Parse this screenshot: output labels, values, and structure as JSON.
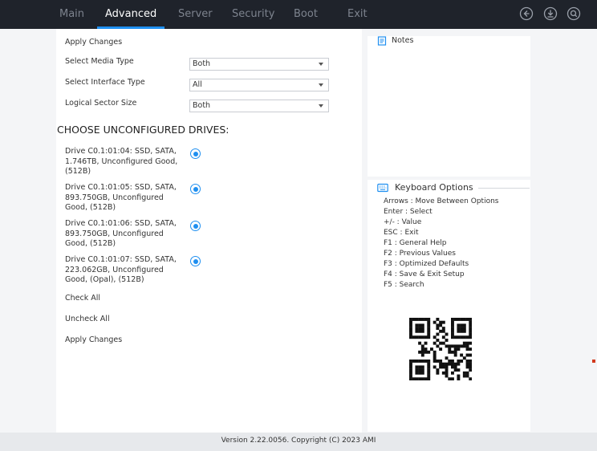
{
  "nav": {
    "tabs": [
      {
        "label": "Main"
      },
      {
        "label": "Advanced"
      },
      {
        "label": "Server"
      },
      {
        "label": "Security"
      },
      {
        "label": "Boot"
      },
      {
        "label": "Exit"
      }
    ],
    "active_tab": "Advanced",
    "icons": [
      "back-icon",
      "save-icon",
      "search-icon"
    ]
  },
  "form": {
    "apply_top": "Apply Changes",
    "media_label": "Select Media Type",
    "media_value": "Both",
    "interface_label": "Select Interface Type",
    "interface_value": "All",
    "sector_label": "Logical Sector Size",
    "sector_value": "Both",
    "heading": "CHOOSE UNCONFIGURED DRIVES:",
    "drives": [
      {
        "lines": [
          "Drive C0.1:01:04: SSD, SATA,",
          "1.746TB, Unconfigured Good,",
          "(512B)"
        ],
        "selected": true
      },
      {
        "lines": [
          "Drive C0.1:01:05: SSD, SATA,",
          "893.750GB, Unconfigured",
          "Good, (512B)"
        ],
        "selected": true
      },
      {
        "lines": [
          "Drive C0.1:01:06: SSD, SATA,",
          "893.750GB, Unconfigured",
          "Good, (512B)"
        ],
        "selected": true
      },
      {
        "lines": [
          "Drive C0.1:01:07: SSD, SATA,",
          "223.062GB, Unconfigured",
          "Good, (Opal), (512B)"
        ],
        "selected": true
      }
    ],
    "check_all": "Check All",
    "uncheck_all": "Uncheck All",
    "apply_bottom": "Apply Changes"
  },
  "notes": {
    "title": "Notes"
  },
  "keyboard": {
    "title": "Keyboard Options",
    "lines": [
      "Arrows : Move Between Options",
      "Enter   : Select",
      "+/-      : Value",
      "ESC     : Exit",
      "F1       : General Help",
      "F2       : Previous Values",
      "F3       : Optimized Defaults",
      "F4       : Save & Exit Setup",
      "F5       : Search"
    ]
  },
  "footer": {
    "text": "Version 2.22.0056. Copyright (C) 2023 AMI"
  },
  "colors": {
    "accent": "#1f8ff0",
    "topbar": "#1f232b"
  }
}
